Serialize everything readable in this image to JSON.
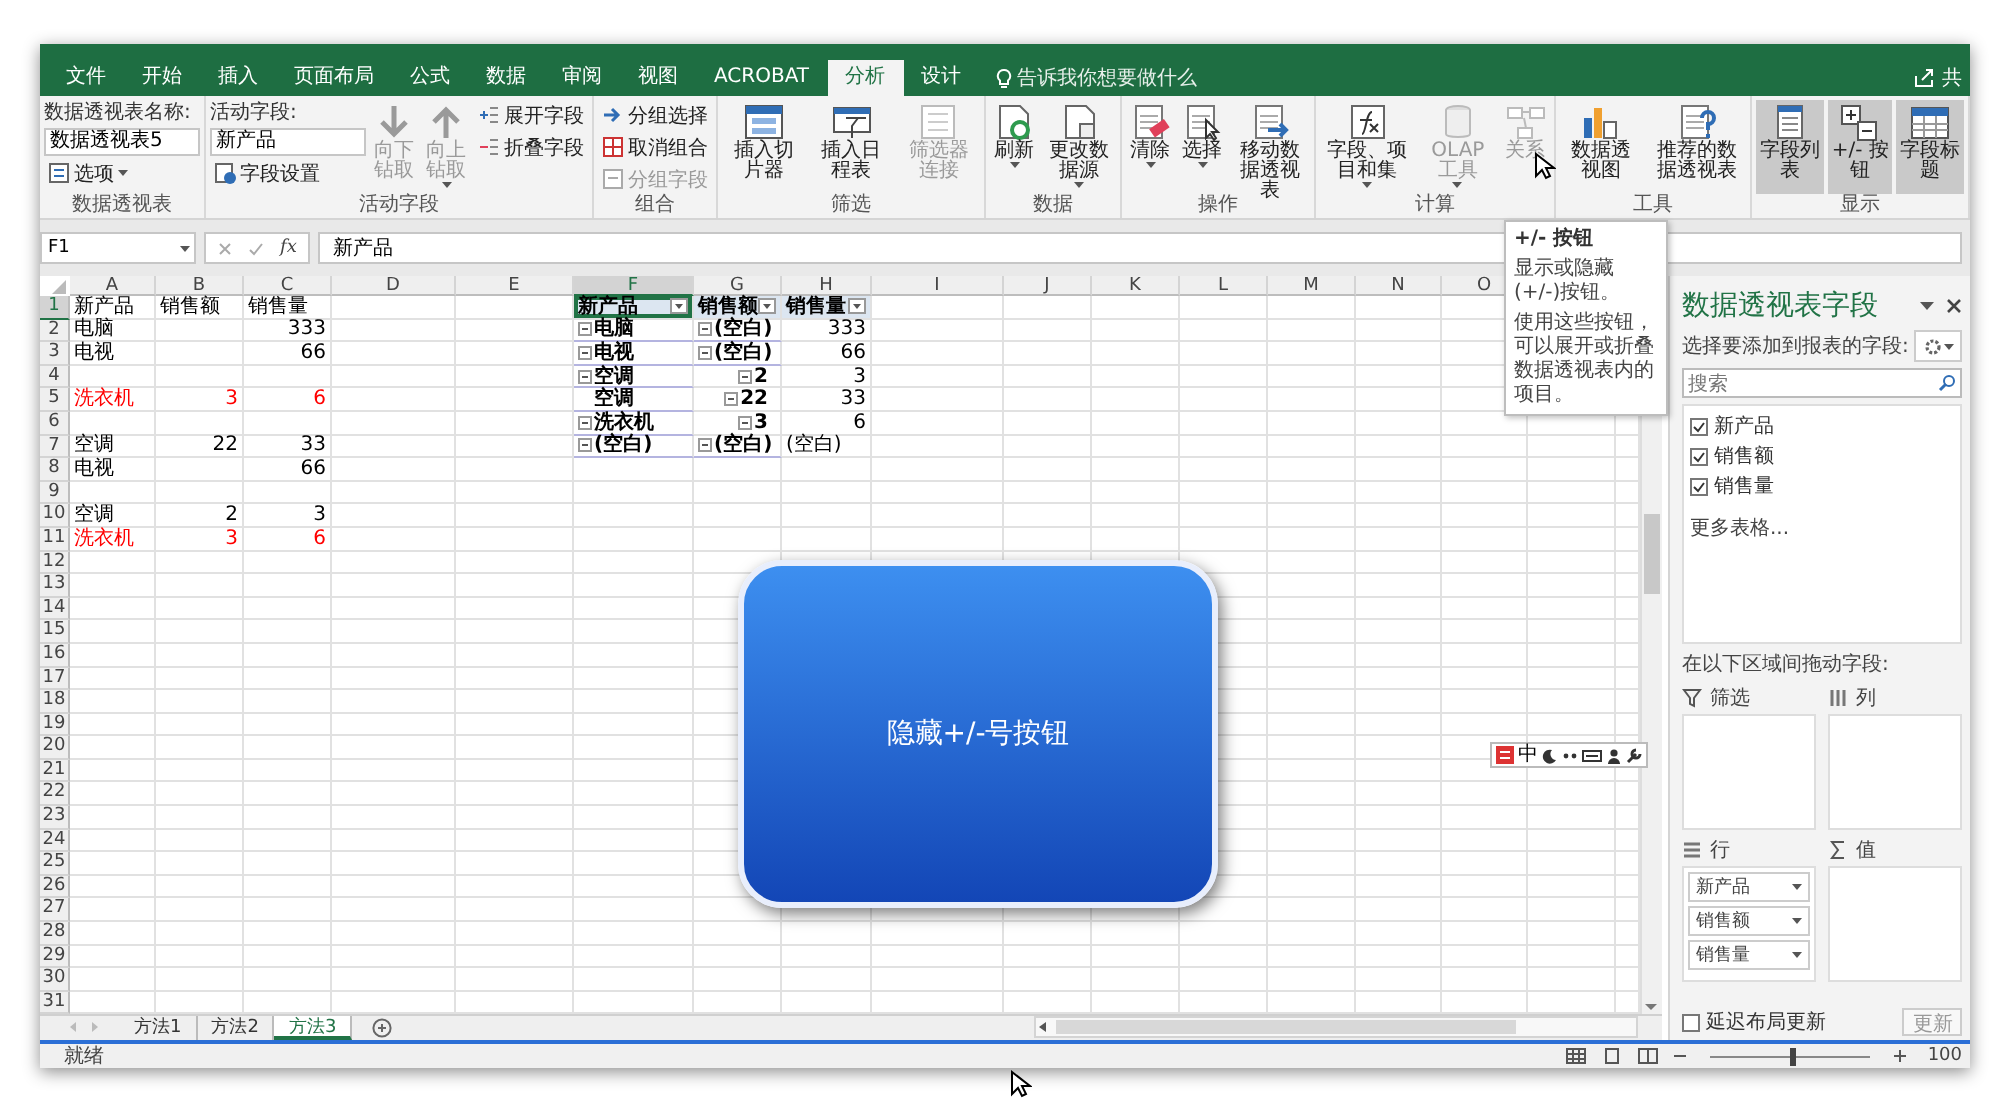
{
  "tabs": [
    {
      "label": "文件",
      "selected": false
    },
    {
      "label": "开始",
      "selected": false
    },
    {
      "label": "插入",
      "selected": false
    },
    {
      "label": "页面布局",
      "selected": false
    },
    {
      "label": "公式",
      "selected": false
    },
    {
      "label": "数据",
      "selected": false
    },
    {
      "label": "审阅",
      "selected": false
    },
    {
      "label": "视图",
      "selected": false
    },
    {
      "label": "ACROBAT",
      "selected": false
    },
    {
      "label": "分析",
      "selected": true
    },
    {
      "label": "设计",
      "selected": false
    }
  ],
  "tell_me": {
    "placeholder": "告诉我你想要做什么"
  },
  "share": "共",
  "ribbon_groups": [
    {
      "label": "数据透视表",
      "columns": [
        [
          {
            "kind": "caption",
            "text": "数据透视表名称:"
          },
          {
            "kind": "field",
            "value": "数据透视表5"
          },
          {
            "kind": "small",
            "label": "选项",
            "dropdown": true,
            "disabled": false
          }
        ]
      ]
    },
    {
      "label": "活动字段",
      "columns": [
        [
          {
            "kind": "caption",
            "text": "活动字段:"
          },
          {
            "kind": "field",
            "value": "新产品"
          },
          {
            "kind": "small",
            "label": "字段设置",
            "dropdown": false,
            "disabled": false
          }
        ],
        [
          {
            "kind": "large",
            "label": "向下钻取",
            "dropdown": false,
            "disabled": true
          }
        ],
        [
          {
            "kind": "large",
            "label": "向上钻取",
            "dropdown": true,
            "disabled": true
          }
        ],
        [
          {
            "kind": "small",
            "label": "展开字段",
            "dropdown": false,
            "disabled": false
          },
          {
            "kind": "small",
            "label": "折叠字段",
            "dropdown": false,
            "disabled": false
          }
        ]
      ]
    },
    {
      "label": "组合",
      "columns": [
        [
          {
            "kind": "small",
            "label": "分组选择",
            "dropdown": false,
            "disabled": false
          },
          {
            "kind": "small",
            "label": "取消组合",
            "dropdown": false,
            "disabled": false
          },
          {
            "kind": "small",
            "label": "分组字段",
            "dropdown": false,
            "disabled": true
          }
        ]
      ]
    },
    {
      "label": "筛选",
      "columns": [
        [
          {
            "kind": "large",
            "label": "插入切片器",
            "dropdown": false,
            "disabled": false
          }
        ],
        [
          {
            "kind": "large",
            "label": "插入日程表",
            "dropdown": false,
            "disabled": false
          }
        ],
        [
          {
            "kind": "large",
            "label": "筛选器连接",
            "dropdown": false,
            "disabled": true
          }
        ]
      ]
    },
    {
      "label": "数据",
      "columns": [
        [
          {
            "kind": "large",
            "label": "刷新",
            "dropdown": true,
            "disabled": false
          }
        ],
        [
          {
            "kind": "large",
            "label": "更改数据源",
            "dropdown": true,
            "disabled": false
          }
        ]
      ]
    },
    {
      "label": "操作",
      "columns": [
        [
          {
            "kind": "large",
            "label": "清除",
            "dropdown": true,
            "disabled": false
          }
        ],
        [
          {
            "kind": "large",
            "label": "选择",
            "dropdown": true,
            "disabled": false
          }
        ],
        [
          {
            "kind": "large",
            "label": "移动数据透视表",
            "dropdown": false,
            "disabled": false
          }
        ]
      ]
    },
    {
      "label": "计算",
      "columns": [
        [
          {
            "kind": "large",
            "label": "字段、项目和集",
            "dropdown": true,
            "disabled": false
          }
        ],
        [
          {
            "kind": "large",
            "label": "OLAP 工具",
            "dropdown": true,
            "disabled": true
          }
        ],
        [
          {
            "kind": "large",
            "label": "关系",
            "dropdown": false,
            "disabled": true
          }
        ]
      ]
    },
    {
      "label": "工具",
      "columns": [
        [
          {
            "kind": "large",
            "label": "数据透视图",
            "dropdown": false,
            "disabled": false
          }
        ],
        [
          {
            "kind": "large",
            "label": "推荐的数据透视表",
            "dropdown": false,
            "disabled": false
          }
        ]
      ]
    },
    {
      "label": "显示",
      "columns": [
        [
          {
            "kind": "large",
            "label": "字段列表",
            "dropdown": false,
            "disabled": false,
            "on": true
          }
        ],
        [
          {
            "kind": "large",
            "label": "+/- 按钮",
            "dropdown": false,
            "disabled": false,
            "on": true
          }
        ],
        [
          {
            "kind": "large",
            "label": "字段标题",
            "dropdown": false,
            "disabled": false,
            "on": true
          }
        ]
      ]
    }
  ],
  "tooltip": {
    "title": "+/- 按钮",
    "lines": [
      "显示或隐藏(+/-)按钮。",
      "使用这些按钮，可以展开或折叠数据透视表内的项目。"
    ]
  },
  "formula_bar": {
    "name_box": "F1",
    "insert_function": "fx",
    "value": "新产品"
  },
  "sheet": {
    "columns": [
      "A",
      "B",
      "C",
      "D",
      "E",
      "F",
      "G",
      "H",
      "I",
      "J",
      "K",
      "L",
      "M",
      "N",
      "O"
    ],
    "rows": [
      {
        "header": "1",
        "cells": {
          "A": {
            "text": "新产品",
            "kind": "text",
            "selected": false
          },
          "B": {
            "text": "销售额",
            "kind": "text",
            "selected": false
          },
          "C": {
            "text": "销售量",
            "kind": "text",
            "selected": false
          },
          "F": {
            "text": "新产品",
            "kind": "pivot-header",
            "selected": true
          },
          "G": {
            "text": "销售额",
            "kind": "pivot-header",
            "selected": false
          },
          "H": {
            "text": "销售量",
            "kind": "pivot-header",
            "selected": false
          }
        }
      },
      {
        "header": "2",
        "cells": {
          "A": {
            "text": "电脑",
            "kind": "text",
            "selected": false
          },
          "C": {
            "text": "333",
            "kind": "number",
            "selected": false
          },
          "F": {
            "text": "电脑",
            "kind": "pivot-item",
            "expanded": true,
            "selected": false
          },
          "G": {
            "text": "(空白)",
            "kind": "pivot-item",
            "expanded": true,
            "selected": false
          },
          "H": {
            "text": "333",
            "kind": "number",
            "selected": false
          }
        }
      },
      {
        "header": "3",
        "cells": {
          "A": {
            "text": "电视",
            "kind": "text",
            "selected": false
          },
          "C": {
            "text": "66",
            "kind": "number",
            "selected": false
          },
          "F": {
            "text": "电视",
            "kind": "pivot-item",
            "expanded": true,
            "selected": false
          },
          "G": {
            "text": "(空白)",
            "kind": "pivot-item",
            "expanded": true,
            "selected": false
          },
          "H": {
            "text": "66",
            "kind": "number",
            "selected": false
          }
        }
      },
      {
        "header": "4",
        "cells": {
          "F": {
            "text": "空调",
            "kind": "pivot-item",
            "expanded": true,
            "selected": false
          },
          "G": {
            "text": "2",
            "kind": "pivot-number",
            "expanded": true,
            "selected": false
          },
          "H": {
            "text": "3",
            "kind": "number",
            "selected": false
          }
        }
      },
      {
        "header": "5",
        "cells": {
          "A": {
            "text": "洗衣机",
            "kind": "text",
            "color": "#ff0000",
            "selected": false
          },
          "B": {
            "text": "3",
            "kind": "number",
            "color": "#ff0000",
            "selected": false
          },
          "C": {
            "text": "6",
            "kind": "number",
            "color": "#ff0000",
            "selected": false
          },
          "F": {
            "text": "空调",
            "kind": "pivot-item",
            "selected": false
          },
          "G": {
            "text": "22",
            "kind": "pivot-number",
            "expanded": true,
            "selected": false
          },
          "H": {
            "text": "33",
            "kind": "number",
            "selected": false
          }
        }
      },
      {
        "header": "6",
        "cells": {
          "F": {
            "text": "洗衣机",
            "kind": "pivot-item",
            "expanded": true,
            "selected": false
          },
          "G": {
            "text": "3",
            "kind": "pivot-number",
            "expanded": true,
            "selected": false
          },
          "H": {
            "text": "6",
            "kind": "number",
            "selected": false
          }
        }
      },
      {
        "header": "7",
        "cells": {
          "A": {
            "text": "空调",
            "kind": "text",
            "selected": false
          },
          "B": {
            "text": "22",
            "kind": "number",
            "selected": false
          },
          "C": {
            "text": "33",
            "kind": "number",
            "selected": false
          },
          "F": {
            "text": "(空白)",
            "kind": "pivot-item",
            "expanded": true,
            "selected": false
          },
          "G": {
            "text": "(空白)",
            "kind": "pivot-item",
            "expanded": true,
            "selected": false
          },
          "H": {
            "text": "(空白)",
            "kind": "text",
            "selected": false
          }
        }
      },
      {
        "header": "8",
        "cells": {
          "A": {
            "text": "电视",
            "kind": "text",
            "selected": false
          },
          "C": {
            "text": "66",
            "kind": "number",
            "selected": false
          }
        }
      },
      {
        "header": "9"
      },
      {
        "header": "10",
        "cells": {
          "A": {
            "text": "空调",
            "kind": "text",
            "selected": false
          },
          "B": {
            "text": "2",
            "kind": "number",
            "selected": false
          },
          "C": {
            "text": "3",
            "kind": "number",
            "selected": false
          }
        }
      },
      {
        "header": "11",
        "cells": {
          "A": {
            "text": "洗衣机",
            "kind": "text",
            "color": "#ff0000",
            "selected": false
          },
          "B": {
            "text": "3",
            "kind": "number",
            "color": "#ff0000",
            "selected": false
          },
          "C": {
            "text": "6",
            "kind": "number",
            "color": "#ff0000",
            "selected": false
          }
        }
      },
      {
        "header": "12"
      },
      {
        "header": "13"
      },
      {
        "header": "14"
      },
      {
        "header": "15"
      },
      {
        "header": "16"
      },
      {
        "header": "17"
      },
      {
        "header": "18"
      },
      {
        "header": "19"
      },
      {
        "header": "20"
      },
      {
        "header": "21"
      },
      {
        "header": "22"
      },
      {
        "header": "23"
      },
      {
        "header": "24"
      },
      {
        "header": "25"
      },
      {
        "header": "26"
      },
      {
        "header": "27"
      },
      {
        "header": "28"
      },
      {
        "header": "29"
      },
      {
        "header": "30"
      },
      {
        "header": "31"
      }
    ]
  },
  "callout": {
    "text": "隐藏+/-号按钮"
  },
  "ime_bar": {
    "mode": "中"
  },
  "pivot_pane": {
    "title": "数据透视表字段",
    "prompt": "选择要添加到报表的字段:",
    "search": {
      "placeholder": "搜索"
    },
    "fields": [
      {
        "label": "新产品",
        "checked": true
      },
      {
        "label": "销售额",
        "checked": true
      },
      {
        "label": "销售量",
        "checked": true
      }
    ],
    "more_tables": "更多表格...",
    "areas_prompt": "在以下区域间拖动字段:",
    "areas": [
      {
        "label": "筛选",
        "kind": "filter"
      },
      {
        "label": "列",
        "kind": "columns"
      },
      {
        "label": "行",
        "kind": "rows",
        "items": [
          "新产品",
          "销售额",
          "销售量"
        ]
      },
      {
        "label": "值",
        "kind": "values"
      }
    ],
    "defer": {
      "label": "延迟布局更新",
      "checked": false
    },
    "update_button": "更新"
  },
  "sheet_tabs": [
    {
      "label": "方法1",
      "selected": false
    },
    {
      "label": "方法2",
      "selected": false
    },
    {
      "label": "方法3",
      "selected": true
    }
  ],
  "status_bar": {
    "text": "就绪",
    "zoom": {
      "level": 0.5,
      "reading": "100"
    }
  }
}
